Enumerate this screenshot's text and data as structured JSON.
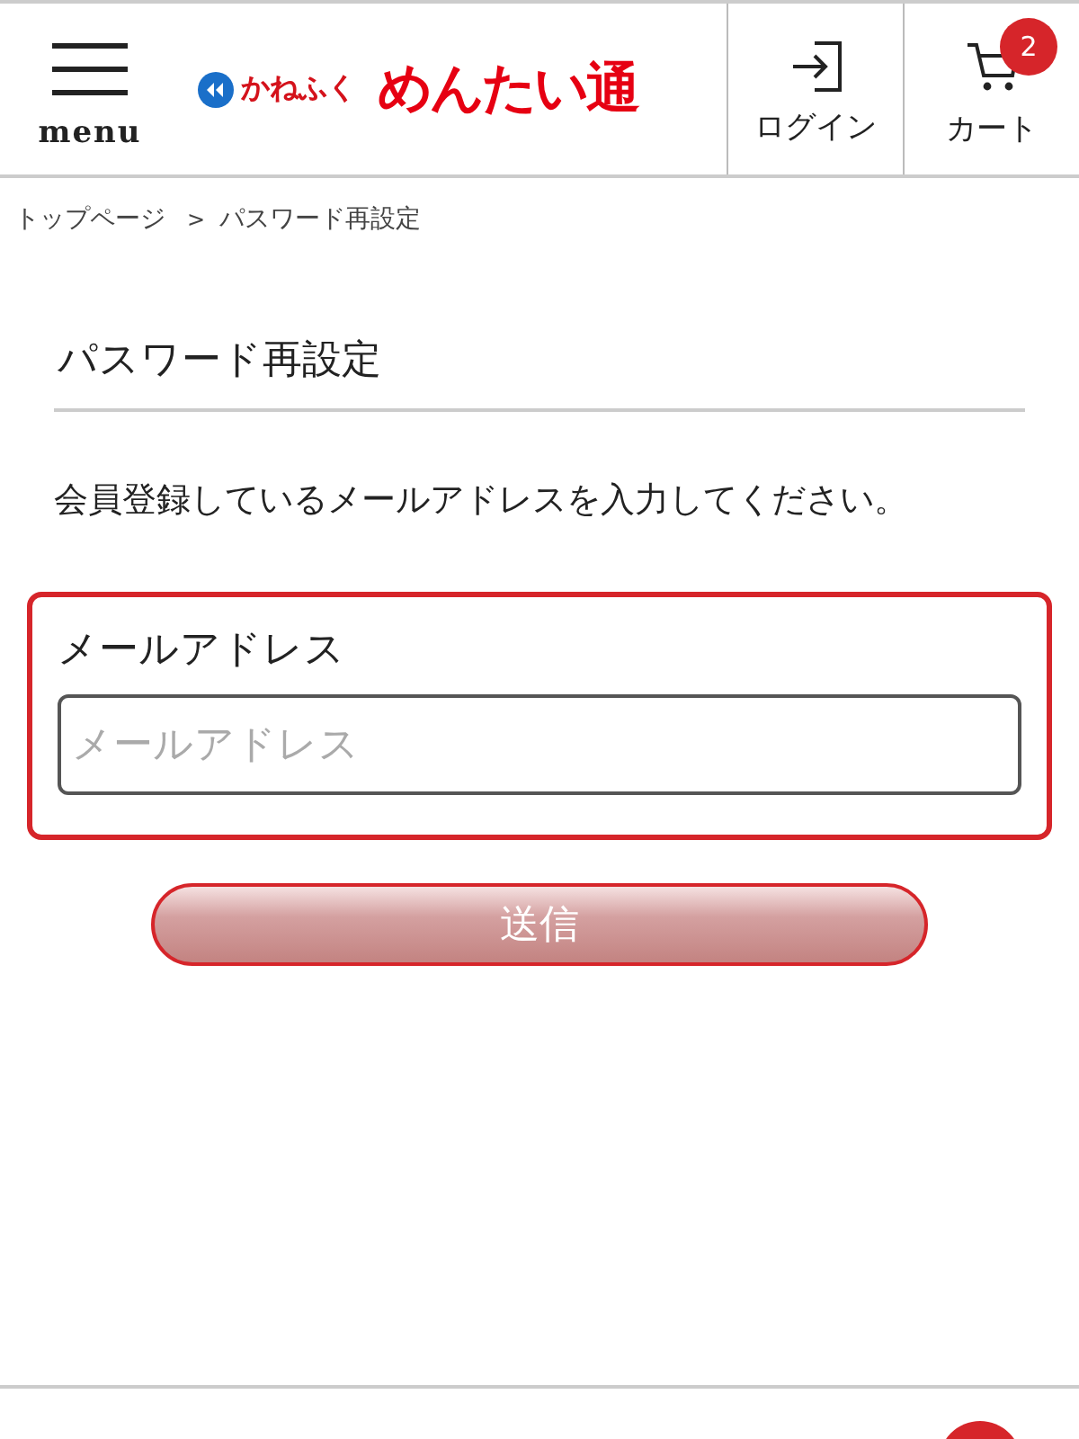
{
  "header": {
    "menu_label": "menu",
    "logo": {
      "brand": "かねふく",
      "name": "めんたい通"
    },
    "login_label": "ログイン",
    "cart": {
      "label": "カート",
      "count": "2"
    }
  },
  "breadcrumb": [
    {
      "label": "トップページ"
    },
    {
      "label": "パスワード再設定"
    }
  ],
  "breadcrumb_separator": ">",
  "page_title": "パスワード再設定",
  "description": "会員登録しているメールアドレスを入力してください。",
  "form": {
    "label": "メールアドレス",
    "placeholder": "メールアドレス",
    "error": true
  },
  "submit": {
    "label": "送信",
    "disabled": true
  }
}
